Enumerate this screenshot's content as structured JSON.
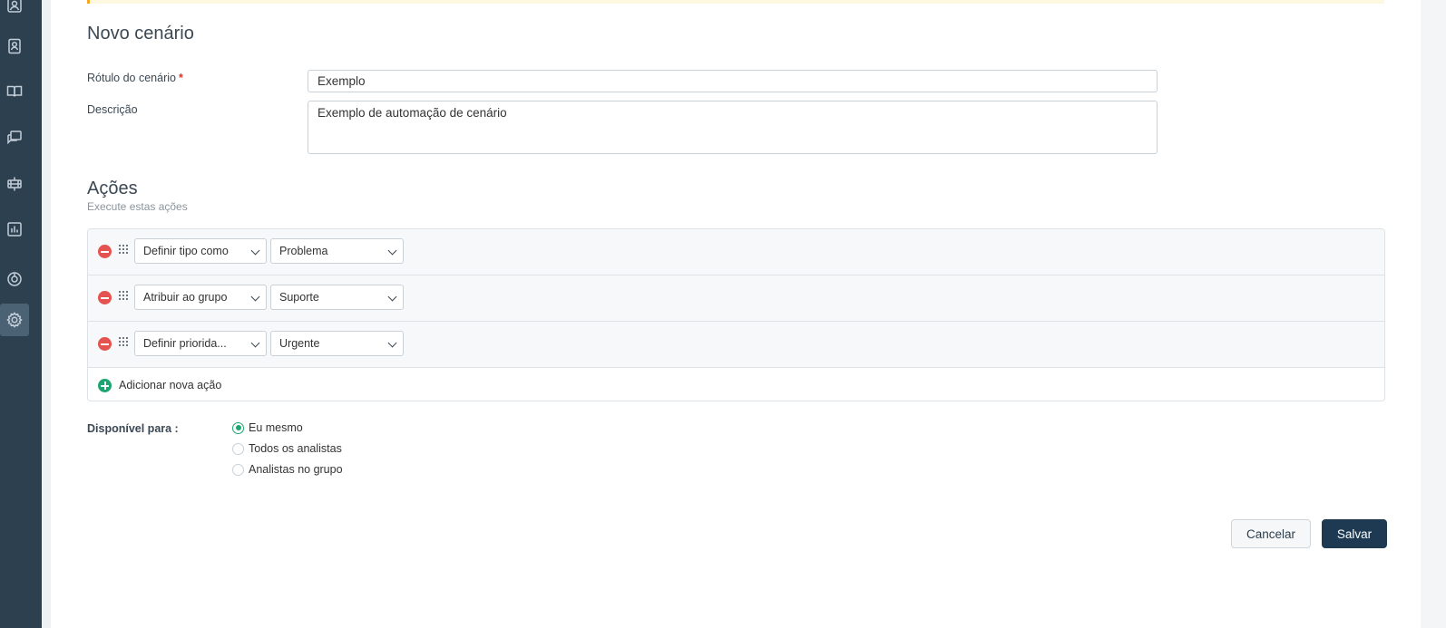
{
  "sidebar": {
    "icons": [
      "contact-icon",
      "knowledge-book-icon",
      "conversations-icon",
      "admin-icon",
      "reports-icon",
      "chat-icon",
      "settings-icon"
    ]
  },
  "form": {
    "title": "Novo cenário",
    "label_field": {
      "label": "Rótulo do cenário",
      "required_mark": "*",
      "value": "Exemplo"
    },
    "description_field": {
      "label": "Descrição",
      "value": "Exemplo de automação de cenário"
    }
  },
  "actions": {
    "title": "Ações",
    "subtitle": "Execute estas ações",
    "rows": [
      {
        "action": "Definir tipo como",
        "value": "Problema"
      },
      {
        "action": "Atribuir ao grupo",
        "value": "Suporte"
      },
      {
        "action": "Definir priorida...",
        "value": "Urgente"
      }
    ],
    "add_label": "Adicionar nova ação"
  },
  "availability": {
    "label": "Disponível para :",
    "options": [
      {
        "label": "Eu mesmo",
        "checked": true
      },
      {
        "label": "Todos os analistas",
        "checked": false
      },
      {
        "label": "Analistas no grupo",
        "checked": false
      }
    ]
  },
  "buttons": {
    "cancel": "Cancelar",
    "save": "Salvar"
  },
  "colors": {
    "sidebar": "#2d4050",
    "primary": "#1d3a52",
    "success": "#1ea672",
    "danger": "#e4534f",
    "warning": "#f5a623"
  }
}
